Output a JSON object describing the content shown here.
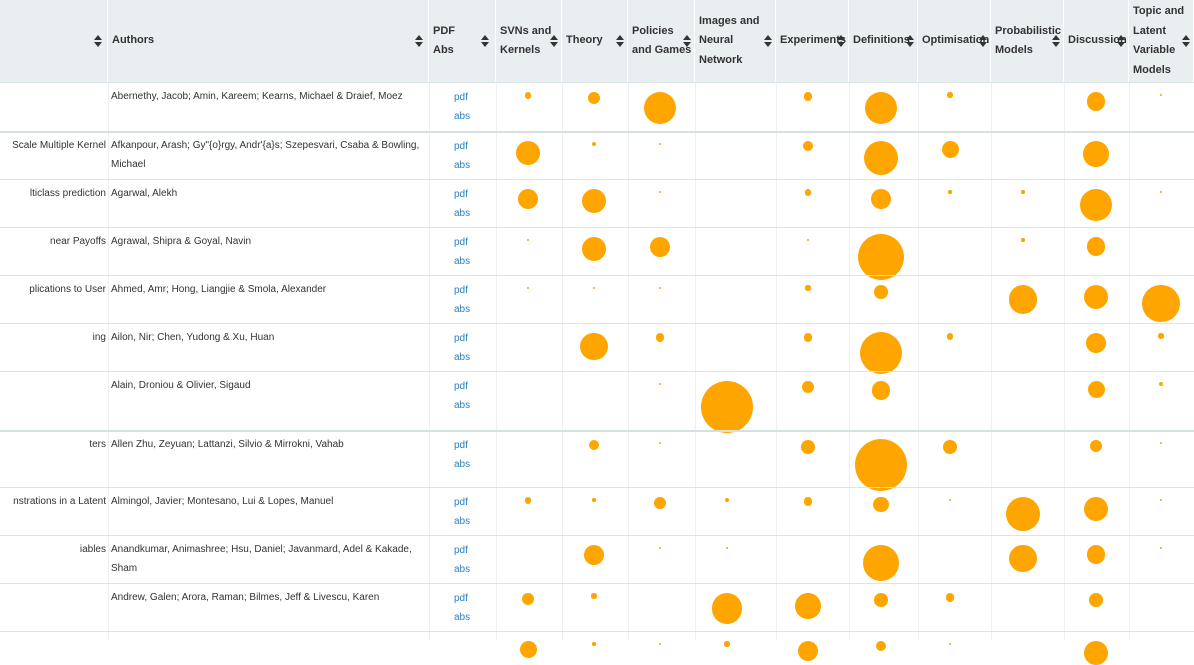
{
  "header": {
    "title_col": "",
    "authors": "Authors",
    "links": [
      "PDF",
      "Abs"
    ],
    "topics": [
      {
        "lines": [
          "SVNs and",
          "Kernels"
        ]
      },
      {
        "lines": [
          "Theory"
        ]
      },
      {
        "lines": [
          "Policies",
          "and Games"
        ]
      },
      {
        "lines": [
          "Images and",
          "Neural",
          "Network"
        ]
      },
      {
        "lines": [
          "Experiments"
        ]
      },
      {
        "lines": [
          "Definitions"
        ]
      },
      {
        "lines": [
          "Optimisation"
        ]
      },
      {
        "lines": [
          "Probabilistic",
          "Models"
        ]
      },
      {
        "lines": [
          "Discussion"
        ]
      },
      {
        "lines": [
          "Topic and",
          "Latent",
          "Variable",
          "Models"
        ]
      }
    ]
  },
  "dot_color": "#ffa500",
  "link_color": "#2a7ec0",
  "rows": [
    {
      "title": "",
      "authors": "Abernethy, Jacob; Amin, Kareem; Kearns, Michael & Draief, Moez",
      "pdf": "pdf",
      "abs": "abs",
      "weights": [
        0.2,
        0.35,
        0.95,
        0,
        0.25,
        0.95,
        0.15,
        0,
        0.55,
        0.03
      ]
    },
    {
      "title": "Scale Multiple Kernel",
      "authors": "Afkanpour, Arash; Gy\"{o}rgy, Andr'{a}s; Szepesvari, Csaba & Bowling, Michael",
      "pdf": "pdf",
      "abs": "abs",
      "weights": [
        0.7,
        0.12,
        0.03,
        0,
        0.3,
        1.0,
        0.5,
        0,
        0.75,
        0
      ]
    },
    {
      "title": "lticlass prediction",
      "authors": "Agarwal, Alekh",
      "pdf": "pdf",
      "abs": "abs",
      "weights": [
        0.6,
        0.7,
        0.03,
        0,
        0.2,
        0.6,
        0.1,
        0.1,
        0.95,
        0.05
      ]
    },
    {
      "title": "near Payoffs",
      "authors": "Agrawal, Shipra & Goyal, Navin",
      "pdf": "pdf",
      "abs": "abs",
      "weights": [
        0.04,
        0.7,
        0.6,
        0,
        0.06,
        1.35,
        0,
        0.1,
        0.55,
        0
      ]
    },
    {
      "title": "plications to User",
      "authors": "Ahmed, Amr; Hong, Liangjie & Smola, Alexander",
      "pdf": "pdf",
      "abs": "abs",
      "weights": [
        0.04,
        0.03,
        0.04,
        0,
        0.15,
        0.4,
        0,
        0.85,
        0.7,
        1.1
      ]
    },
    {
      "title": "ing",
      "authors": "Ailon, Nir; Chen, Yudong & Xu, Huan",
      "pdf": "pdf",
      "abs": "abs",
      "weights": [
        0,
        0.8,
        0.25,
        0,
        0.25,
        1.25,
        0.2,
        0,
        0.6,
        0.15
      ]
    },
    {
      "title": "",
      "authors": "Alain, Droniou & Olivier, Sigaud",
      "pdf": "pdf",
      "abs": "abs",
      "weights": [
        0,
        0,
        0.03,
        1.7,
        0.35,
        0.55,
        0,
        0,
        0.5,
        0.12
      ]
    },
    {
      "title": "ters",
      "authors": "Allen Zhu, Zeyuan; Lattanzi, Silvio & Mirrokni, Vahab",
      "pdf": "pdf",
      "abs": "abs",
      "weights": [
        0,
        0.3,
        0.06,
        0,
        0.4,
        1.6,
        0.4,
        0,
        0.35,
        0.02
      ]
    },
    {
      "title": "nstrations in a Latent",
      "authors": "Almingol, Javier; Montesano, Lui & Lopes, Manuel",
      "pdf": "pdf",
      "abs": "abs",
      "weights": [
        0.2,
        0.1,
        0.35,
        0.12,
        0.25,
        0.45,
        0.04,
        1.0,
        0.7,
        0.08
      ]
    },
    {
      "title": "iables",
      "authors": "Anandkumar, Animashree; Hsu, Daniel; Javanmard, Adel & Kakade, Sham",
      "pdf": "pdf",
      "abs": "abs",
      "weights": [
        0,
        0.6,
        0.03,
        0.02,
        0,
        1.05,
        0,
        0.8,
        0.55,
        0.06
      ]
    },
    {
      "title": "",
      "authors": "Andrew, Galen; Arora, Raman; Bilmes, Jeff & Livescu, Karen",
      "pdf": "pdf",
      "abs": "abs",
      "weights": [
        0.35,
        0.15,
        0,
        0.9,
        0.75,
        0.4,
        0.25,
        0,
        0.4,
        0
      ]
    },
    {
      "title": "",
      "authors": "",
      "pdf": "",
      "abs": "",
      "weights": [
        0.5,
        0.1,
        0.05,
        0.15,
        0.6,
        0.3,
        0.05,
        0,
        0.7,
        0
      ]
    }
  ]
}
